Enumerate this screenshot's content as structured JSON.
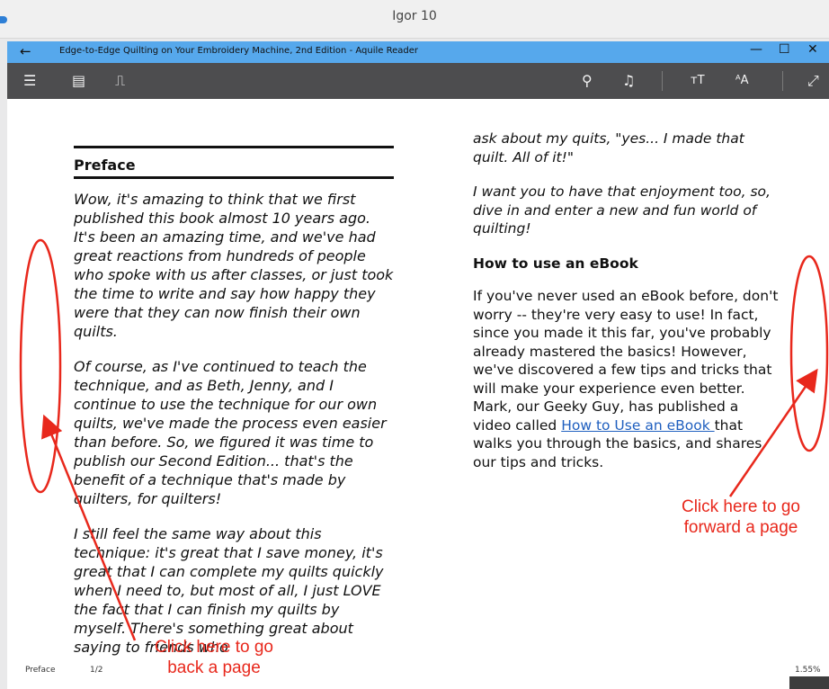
{
  "outer_window": {
    "title": "Igor 10"
  },
  "app": {
    "back_label": "←",
    "title": "Edge-to-Edge Quilting on Your Embroidery Machine, 2nd Edition - Aquile Reader",
    "minimize": "—",
    "maximize": "☐",
    "close": "✕"
  },
  "toolbar": {
    "menu_icon": "☰",
    "toc_icon": "▤",
    "bookmark_icon": "⎍",
    "search_icon": "⚲",
    "read_aloud_icon": "♫",
    "font_size_label": "тT",
    "text_style_label": "ᴬA",
    "fullscreen_icon": "⤢"
  },
  "left_page": {
    "heading": "Preface",
    "paragraphs": [
      "Wow, it's amazing to think that we first published this book almost 10 years ago. It's been an amazing time, and we've had great reactions from hundreds of people who spoke with us after classes, or just took the time to write and say how happy they were that they can now finish their own quilts.",
      "Of course, as I've continued to teach the technique, and as Beth, Jenny, and I continue to use the technique for our own quilts, we've made the process even easier than before. So, we figured it was time to publish our Second Edition... that's the benefit of a technique that's made by quilters, for quilters!",
      "I still feel the same way about this technique: it's great that I save money, it's great that I can complete my quilts quickly when I need to, but most of all, I just LOVE the fact that I can finish my quilts by myself. There's something great about saying to friends who"
    ]
  },
  "right_page": {
    "p1": "ask about my quits, \"yes... I made that quilt. All of it!\"",
    "p2": "I want you to have that enjoyment too, so, dive in and enter a new and fun world of quilting!",
    "heading": "How to use an eBook",
    "body_before_link": "If you've never used an eBook before, don't worry -- they're very easy to use! In fact, since you made it this far, you've probably already mastered the basics! However, we've discovered a few tips and tricks that will make your experience even better. Mark, our Geeky Guy, has published a video called ",
    "link_text": "How to Use an eBook ",
    "body_after_link": "that walks you through the basics, and shares our tips and tricks."
  },
  "status": {
    "chapter": "Preface",
    "page": "1/2",
    "progress": "1.55%"
  },
  "annotations": {
    "back": {
      "line1": "Click here to go",
      "line2": "back a page"
    },
    "forward": {
      "line1": "Click here to go",
      "line2": "forward a page"
    }
  },
  "colors": {
    "annotation": "#e8281c",
    "app_titlebar": "#56a8ec",
    "toolbar": "#4d4d4f",
    "link": "#1f5fbf"
  }
}
